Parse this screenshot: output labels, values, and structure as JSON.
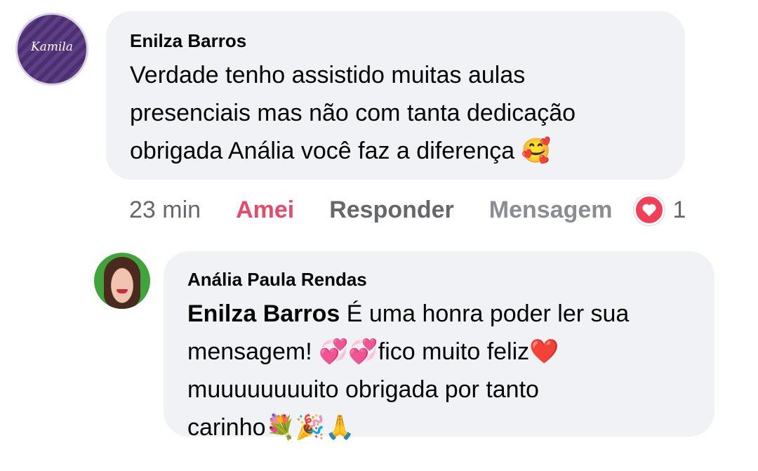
{
  "comment": {
    "author": "Enilza Barros",
    "avatar_logo": "Kamila",
    "text": "Verdade tenho assistido muitas aulas\npresenciais mas não com tanta dedicação\nobrigada Anália você faz a diferença 🥰",
    "actions": {
      "time": "23 min",
      "love_label": "Amei",
      "reply_label": "Responder",
      "message_label": "Mensagem",
      "reaction_count": "1"
    }
  },
  "reply": {
    "author": "Anália Paula Rendas",
    "mention": "Enilza Barros",
    "text": " É uma honra poder ler sua\nmensagem! 💞💞fico muito feliz❤️\nmuuuuuuuuito obrigada por tanto\ncarinho💐🎉🙏"
  },
  "colors": {
    "bubble": "#f0f2f5",
    "love": "#e8496a",
    "muted": "#65676b",
    "heart_badge": "#f33e58"
  }
}
